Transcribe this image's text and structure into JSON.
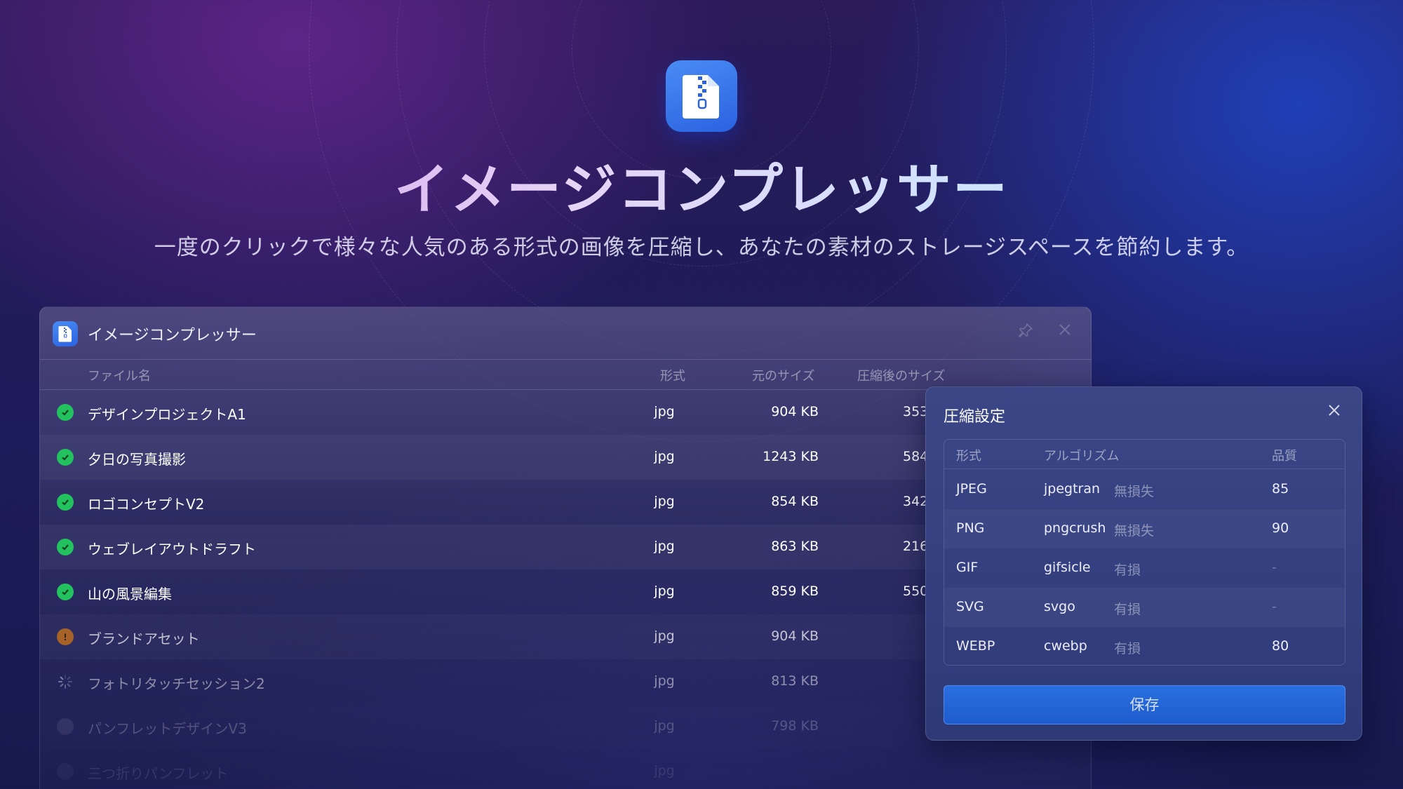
{
  "hero": {
    "title": "イメージコンプレッサー",
    "subtitle": "一度のクリックで様々な人気のある形式の画像を圧縮し、あなたの素材のストレージスペースを節約します。",
    "icon": "zip-file-icon"
  },
  "window": {
    "title": "イメージコンプレッサー",
    "icon": "zip-file-icon",
    "controls": [
      "pin-icon",
      "close-icon"
    ],
    "columns": {
      "name": "ファイル名",
      "type": "形式",
      "original": "元のサイズ",
      "compressed": "圧縮後のサイズ"
    },
    "files": [
      {
        "status": "done",
        "name": "デザインプロジェクトA1",
        "type": "jpg",
        "size": "904 KB",
        "after": "353"
      },
      {
        "status": "done",
        "name": "夕日の写真撮影",
        "type": "jpg",
        "size": "1243 KB",
        "after": "584"
      },
      {
        "status": "done",
        "name": "ロゴコンセプトV2",
        "type": "jpg",
        "size": "854 KB",
        "after": "342"
      },
      {
        "status": "done",
        "name": "ウェブレイアウトドラフト",
        "type": "jpg",
        "size": "863 KB",
        "after": "216"
      },
      {
        "status": "done",
        "name": "山の風景編集",
        "type": "jpg",
        "size": "859 KB",
        "after": "550"
      },
      {
        "status": "warning",
        "name": "ブランドアセット",
        "type": "jpg",
        "size": "904 KB",
        "after": ""
      },
      {
        "status": "loading",
        "name": "フォトリタッチセッション2",
        "type": "jpg",
        "size": "813 KB",
        "after": ""
      },
      {
        "status": "pending",
        "name": "パンフレットデザインV3",
        "type": "jpg",
        "size": "798 KB",
        "after": ""
      },
      {
        "status": "pending",
        "name": "三つ折りパンフレット",
        "type": "jpg",
        "size": "",
        "after": ""
      }
    ]
  },
  "dialog": {
    "title": "圧縮設定",
    "columns": {
      "format": "形式",
      "algorithm": "アルゴリズム",
      "quality": "品質"
    },
    "rows": [
      {
        "format": "JPEG",
        "algorithm": "jpegtran",
        "mode": "無損失",
        "quality": "85"
      },
      {
        "format": "PNG",
        "algorithm": "pngcrush",
        "mode": "無損失",
        "quality": "90"
      },
      {
        "format": "GIF",
        "algorithm": "gifsicle",
        "mode": "有損",
        "quality": "-"
      },
      {
        "format": "SVG",
        "algorithm": "svgo",
        "mode": "有損",
        "quality": "-"
      },
      {
        "format": "WEBP",
        "algorithm": "cwebp",
        "mode": "有損",
        "quality": "80"
      }
    ],
    "save_label": "保存"
  },
  "colors": {
    "accent": "#2a6fe0",
    "success": "#22c35e",
    "warning": "#d97a14"
  }
}
